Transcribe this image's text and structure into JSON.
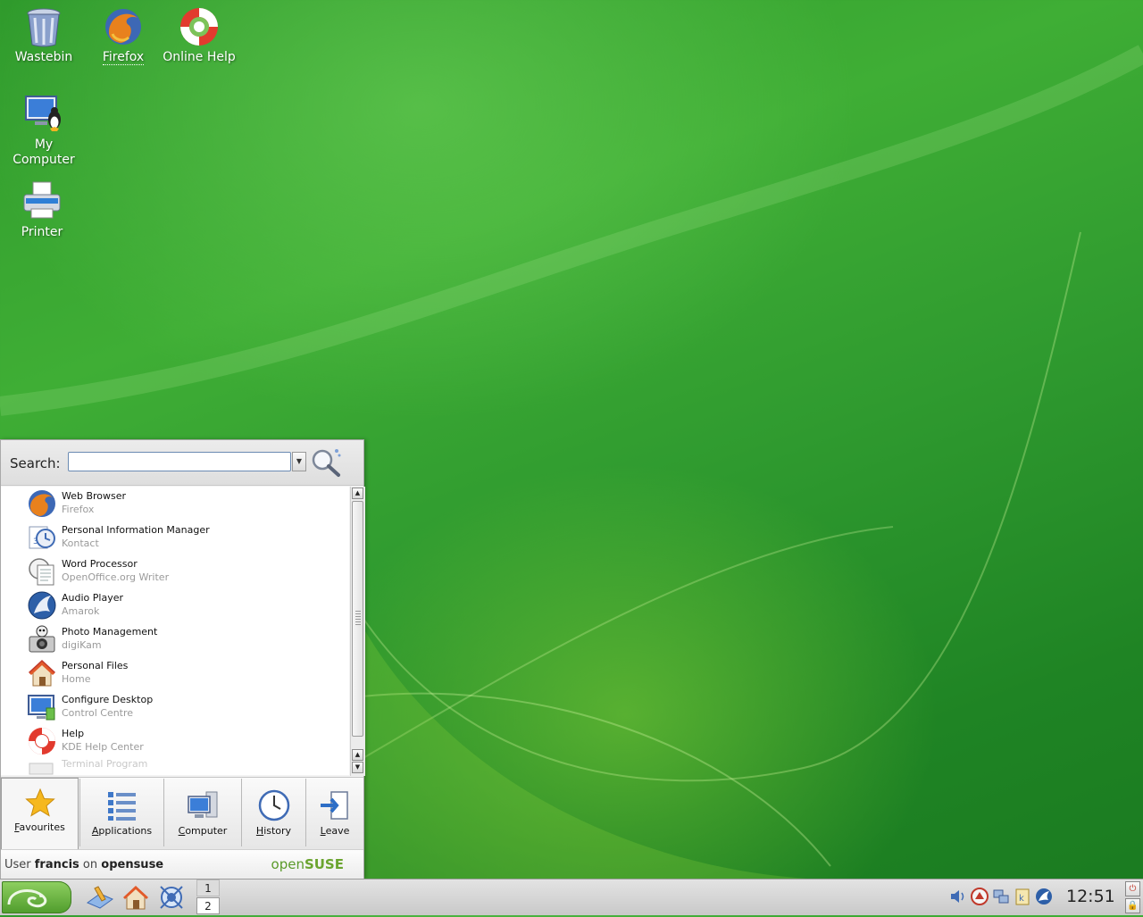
{
  "desktop": {
    "icons": [
      {
        "label": "Wastebin",
        "icon": "trash-icon"
      },
      {
        "label": "Firefox",
        "icon": "firefox-icon"
      },
      {
        "label": "Online Help",
        "icon": "lifebuoy-icon"
      },
      {
        "label_line1": "My",
        "label_line2": "Computer",
        "icon": "computer-icon"
      },
      {
        "label": "Printer",
        "icon": "printer-icon"
      }
    ]
  },
  "menu": {
    "search_label": "Search:",
    "search_value": "",
    "items": [
      {
        "title": "Web Browser",
        "subtitle": "Firefox",
        "icon": "firefox-icon"
      },
      {
        "title": "Personal Information Manager",
        "subtitle": "Kontact",
        "icon": "kontact-icon"
      },
      {
        "title": "Word Processor",
        "subtitle": "OpenOffice.org Writer",
        "icon": "writer-icon"
      },
      {
        "title": "Audio Player",
        "subtitle": "Amarok",
        "icon": "amarok-icon"
      },
      {
        "title": "Photo Management",
        "subtitle": "digiKam",
        "icon": "camera-icon"
      },
      {
        "title": "Personal Files",
        "subtitle": "Home",
        "icon": "home-icon"
      },
      {
        "title": "Configure Desktop",
        "subtitle": "Control Centre",
        "icon": "control-centre-icon"
      },
      {
        "title": "Help",
        "subtitle": "KDE Help Center",
        "icon": "lifebuoy-icon"
      },
      {
        "title": "",
        "subtitle": "Terminal Program",
        "icon": "terminal-icon"
      }
    ],
    "tabs": [
      {
        "label": "Favourites",
        "underline": "F",
        "rest": "avourites",
        "icon": "star-icon"
      },
      {
        "label": "Applications",
        "underline": "A",
        "rest": "pplications",
        "icon": "list-icon"
      },
      {
        "label": "Computer",
        "underline": "C",
        "rest": "omputer",
        "icon": "computer-icon"
      },
      {
        "label": "History",
        "underline": "H",
        "rest": "istory",
        "icon": "clock-icon"
      },
      {
        "label": "Leave",
        "underline": "L",
        "rest": "eave",
        "icon": "exit-icon"
      }
    ],
    "user_prefix": "User",
    "user_name": "francis",
    "user_on": "on",
    "host_name": "opensuse",
    "brand_open": "open",
    "brand_suse": "SUSE"
  },
  "taskbar": {
    "pager": [
      "1",
      "2"
    ],
    "clock": "12:51",
    "quick_launch": [
      "desktop-icon",
      "home-icon",
      "konqueror-icon"
    ],
    "tray": [
      "volume-icon",
      "updater-icon",
      "network-icon",
      "klipper-icon",
      "kmix-icon"
    ]
  },
  "colors": {
    "desktop": "#2f9a2c",
    "brand": "#6aa42e"
  }
}
